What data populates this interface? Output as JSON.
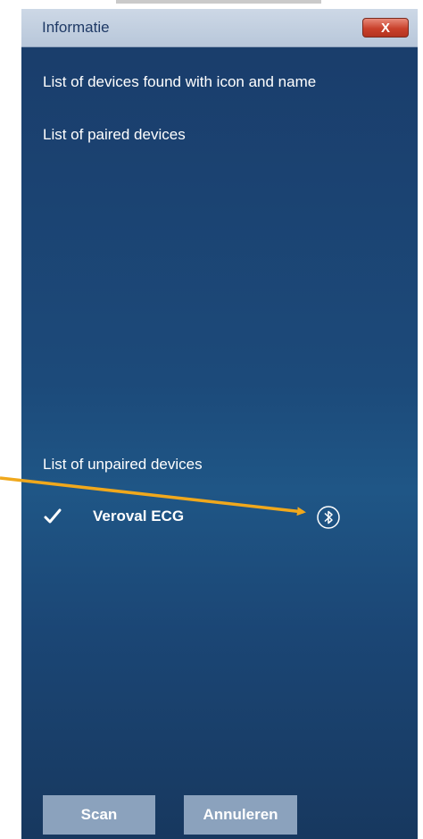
{
  "dialog": {
    "title": "Informatie",
    "close_label": "X"
  },
  "sections": {
    "found_label": "List of devices found with icon and name",
    "paired_label": "List of paired devices",
    "unpaired_label": "List of unpaired devices"
  },
  "unpaired_devices": [
    {
      "name": "Veroval ECG",
      "status_icon": "checkmark-icon",
      "connection_icon": "bluetooth-icon"
    }
  ],
  "buttons": {
    "scan_label": "Scan",
    "cancel_label": "Annuleren"
  },
  "colors": {
    "dialog_bg_top": "#1a3c6a",
    "dialog_bg_mid": "#1f5686",
    "titlebar": "#cdd8e6",
    "close_button": "#c9412b",
    "button_bg": "#8ba2bd",
    "annotation_arrow": "#f0a81c"
  }
}
